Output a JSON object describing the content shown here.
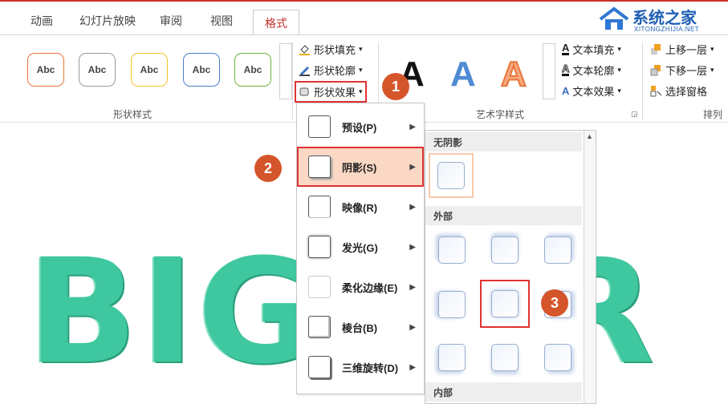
{
  "tabs": [
    "动画",
    "幻灯片放映",
    "审阅",
    "视图",
    "格式"
  ],
  "active_tab": "格式",
  "watermark": {
    "title": "系统之家",
    "subtitle": "XITONGZHIJIA.NET"
  },
  "shape_styles": {
    "samples": [
      "Abc",
      "Abc",
      "Abc",
      "Abc",
      "Abc"
    ],
    "group_label": "形状样式"
  },
  "shape_cmds": {
    "fill": "形状填充",
    "outline": "形状轮廓",
    "effects": "形状效果"
  },
  "wordart": {
    "samples": [
      "A",
      "A",
      "A"
    ],
    "group_label": "艺术字样式",
    "text_fill": "文本填充",
    "text_outline": "文本轮廓",
    "text_effects": "文本效果"
  },
  "arrange": {
    "bring_forward": "上移一层",
    "send_backward": "下移一层",
    "selection_pane": "选择窗格",
    "group_label": "排列"
  },
  "effects_menu": [
    {
      "label": "预设(P)"
    },
    {
      "label": "阴影(S)"
    },
    {
      "label": "映像(R)"
    },
    {
      "label": "发光(G)"
    },
    {
      "label": "柔化边缘(E)"
    },
    {
      "label": "棱台(B)"
    },
    {
      "label": "三维旋转(D)"
    }
  ],
  "shadow_gallery": {
    "no_shadow": "无阴影",
    "outer": "外部",
    "inner": "内部"
  },
  "steps": [
    "1",
    "2",
    "3"
  ],
  "background_text": "BIGGER",
  "colors": {
    "accent": "#c4302b",
    "step_badge": "#d5552a",
    "highlight": "#e03232",
    "art": "#3fc79f"
  }
}
